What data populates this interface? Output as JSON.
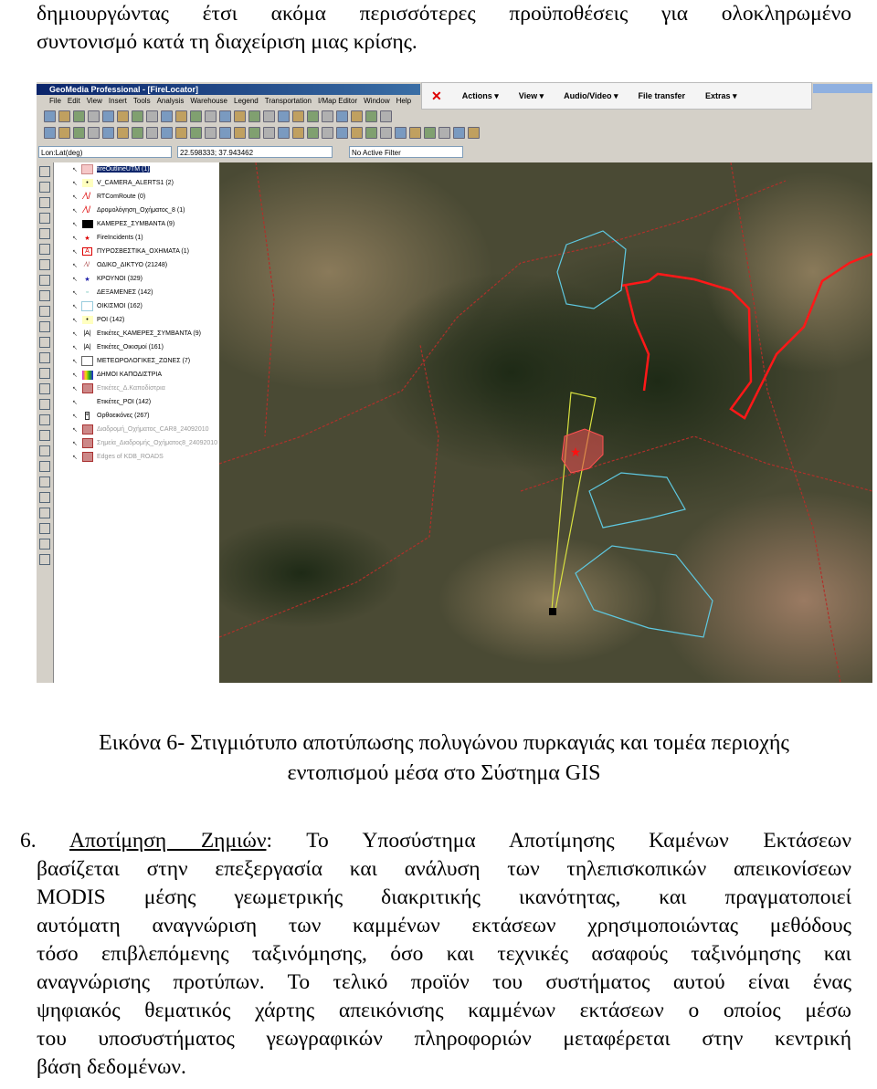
{
  "top_paragraph": {
    "lines": [
      "δημιουργώντας έτσι ακόμα περισσότερες προϋποθέσεις για ολοκληρωμένο",
      "συντονισμό κατά τη διαχείριση μιας κρίσης."
    ]
  },
  "screenshot": {
    "title": "GeoMedia Professional - [FireLocator]",
    "menu": [
      "File",
      "Edit",
      "View",
      "Insert",
      "Tools",
      "Analysis",
      "Warehouse",
      "Legend",
      "Transportation",
      "I/Map Editor",
      "Window",
      "Help"
    ],
    "panel": {
      "close": "✕",
      "items": [
        "Actions ▾",
        "View ▾",
        "Audio/Video ▾",
        "File transfer",
        "Extras ▾"
      ]
    },
    "coord_system": "Lon:Lat(deg)",
    "coordinates": "22.598333; 37.943462",
    "filter": "No Active Filter",
    "legend": [
      {
        "label": "fireOutlineUTM (1)",
        "icon": "pink-area",
        "selected": true
      },
      {
        "label": "V_CAMERA_ALERTS1 (2)",
        "icon": "yellow-point"
      },
      {
        "label": "RTComRoute (0)",
        "icon": "red-line"
      },
      {
        "label": "Δρομολόγηση_Οχήματος_8 (1)",
        "icon": "red-line"
      },
      {
        "label": "ΚΑΜΕΡΕΣ_ΣΥΜΒΑΝΤΑ (9)",
        "icon": "black-area"
      },
      {
        "label": "FireIncidents (1)",
        "icon": "red-star"
      },
      {
        "label": "ΠΥΡΟΣΒΕΣΤΙΚΑ_ΟΧΗΜΑΤΑ (1)",
        "icon": "red-A"
      },
      {
        "label": "ΟΔΙΚΟ_ΔΙΚΤΥΟ (21248)",
        "icon": "road-line"
      },
      {
        "label": "ΚΡΟΥΝΟΙ (329)",
        "icon": "blue-star"
      },
      {
        "label": "ΔΕΞΑΜΕΝΕΣ (142)",
        "icon": "teal-point"
      },
      {
        "label": "ΟΙΚΙΣΜΟΙ (162)",
        "icon": "cyan-area"
      },
      {
        "label": "POI (142)",
        "icon": "yellow-point"
      },
      {
        "label": "Ετικέτες_ΚΑΜΕΡΕΣ_ΣΥΜΒΑΝΤΑ (9)",
        "icon": "label-A"
      },
      {
        "label": "Ετικέτες_Οικισμοί (161)",
        "icon": "label-A"
      },
      {
        "label": "ΜΕΤΕΩΡΟΛΟΓΙΚΕΣ_ΖΩΝΕΣ (7)",
        "icon": "white-area"
      },
      {
        "label": "ΔΗΜΟΙ ΚΑΠΟΔΙΣΤΡΙΑ",
        "icon": "color-area"
      },
      {
        "label": "Ετικέτες_Δ.Καποδίστρια",
        "icon": "raster",
        "dim": true
      },
      {
        "label": "Ετικέτες_POI (142)",
        "icon": "none"
      },
      {
        "label": "Ορθοεικόνες (267)",
        "icon": "image"
      },
      {
        "label": "Διαδρομή_Οχήματος_CAR8_24092010",
        "icon": "raster",
        "dim": true
      },
      {
        "label": "Σημεία_Διαδρομής_Οχήματος8_24092010",
        "icon": "raster",
        "dim": true
      },
      {
        "label": "Edges of KDB_ROADS",
        "icon": "raster",
        "dim": true
      }
    ],
    "colors": {
      "fire": "#e03030",
      "roads": "#c0302a",
      "settlements": "#5ec8e0",
      "camera_sector": "#d8e040"
    }
  },
  "caption": {
    "line1": "Εικόνα 6- Στιγμιότυπο αποτύπωσης πολυγώνου πυρκαγιάς και τομέα περιοχής",
    "line2": "εντοπισμού μέσα στο Σύστημα GIS"
  },
  "item6": {
    "number": "6. ",
    "heading": "Αποτίμηση Ζημιών",
    "lines": [
      ": Το Υποσύστημα Αποτίμησης Καμένων Εκτάσεων",
      "βασίζεται στην επεξεργασία και ανάλυση των τηλεπισκοπικών απεικονίσεων",
      "MODIS μέσης γεωμετρικής διακριτικής ικανότητας, και πραγματοποιεί",
      "αυτόματη αναγνώριση των καμμένων εκτάσεων χρησιμοποιώντας μεθόδους",
      "τόσο επιβλεπόμενης ταξινόμησης, όσο και τεχνικές ασαφούς ταξινόμησης και",
      "αναγνώρισης προτύπων. Το τελικό προϊόν του συστήματος αυτού είναι ένας",
      "ψηφιακός θεματικός χάρτης απεικόνισης καμμένων εκτάσεων ο οποίος μέσω",
      "του υποσυστήματος γεωγραφικών πληροφοριών μεταφέρεται στην κεντρική",
      "βάση δεδομένων."
    ]
  }
}
